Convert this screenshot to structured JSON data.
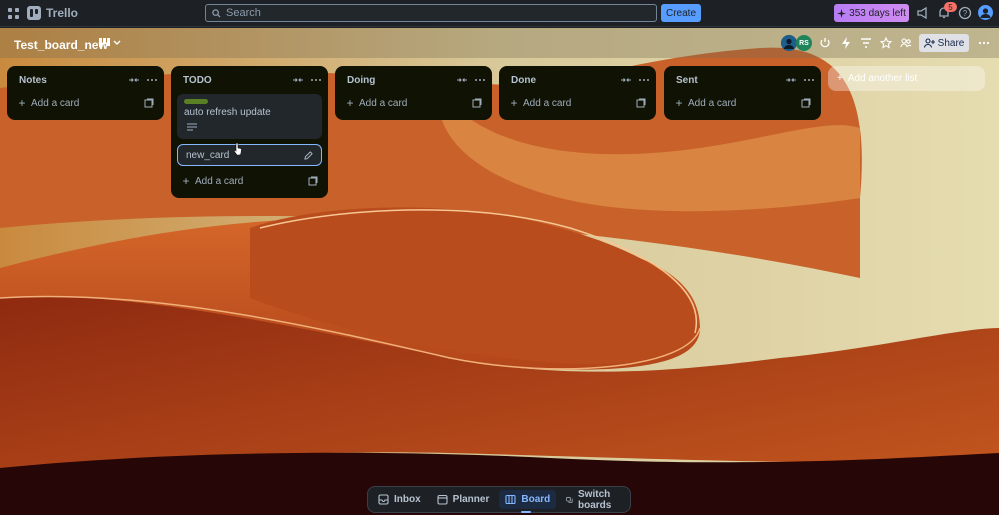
{
  "topbar": {
    "app_name": "Trello",
    "search_placeholder": "Search",
    "create_label": "Create",
    "trial_label": "353 days left",
    "notification_count": "5"
  },
  "board": {
    "title": "Test_board_new",
    "avatar_initials": "RS",
    "share_label": "Share"
  },
  "lists": [
    {
      "title": "Notes",
      "add_label": "Add a card"
    },
    {
      "title": "TODO",
      "add_label": "Add a card",
      "cards": [
        {
          "title": "auto refresh update"
        }
      ],
      "editing_card": "new_card"
    },
    {
      "title": "Doing",
      "add_label": "Add a card"
    },
    {
      "title": "Done",
      "add_label": "Add a card"
    },
    {
      "title": "Sent",
      "add_label": "Add a card"
    }
  ],
  "add_list_label": "Add another list",
  "bottom_nav": {
    "inbox": "Inbox",
    "planner": "Planner",
    "board": "Board",
    "switch": "Switch boards"
  },
  "colors": {
    "create": "#579dff",
    "trial": "#c77dff",
    "label": "#5b7f24",
    "avatar_rs": "#1f845a"
  }
}
